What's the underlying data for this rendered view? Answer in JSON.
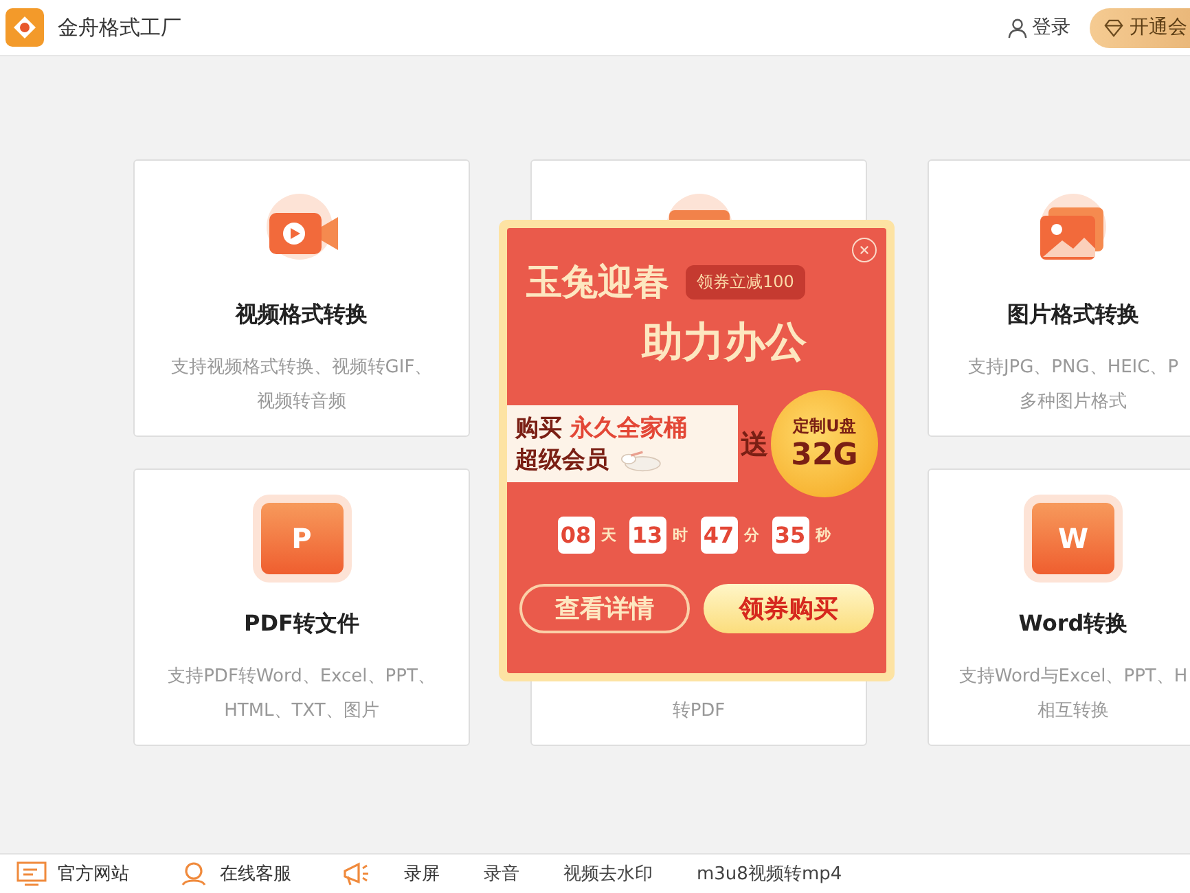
{
  "header": {
    "app_name": "金舟格式工厂",
    "login": "登录",
    "vip_button": "开通会"
  },
  "cards": [
    {
      "kind": "video",
      "title": "视频格式转换",
      "desc_lines": [
        "支持视频格式转换、视频转GIF、",
        "视频转音频"
      ]
    },
    {
      "kind": "covered"
    },
    {
      "kind": "image",
      "title": "图片格式转换",
      "desc_lines": [
        "支持JPG、PNG、HEIC、P",
        "多种图片格式"
      ]
    },
    {
      "kind": "pdf",
      "icon_letter": "P",
      "title": "PDF转文件",
      "desc_lines": [
        "支持PDF转Word、Excel、PPT、",
        "HTML、TXT、图片"
      ]
    },
    {
      "kind": "covered",
      "desc_lines": [
        "转PDF"
      ]
    },
    {
      "kind": "word",
      "icon_letter": "W",
      "title": "Word转换",
      "desc_lines": [
        "支持Word与Excel、PPT、H",
        "相互转换"
      ]
    }
  ],
  "popup": {
    "title_line1": "玉兔迎春",
    "title_line2": "助力办公",
    "coupon_tag": "领券立减100",
    "offer_prefix": "购买",
    "offer_highlight": "永久全家桶",
    "offer_line2": "超级会员",
    "gift_word": "送",
    "gift_line1": "定制U盘",
    "gift_line2": "32G",
    "countdown": [
      {
        "value": "08",
        "unit": "天"
      },
      {
        "value": "13",
        "unit": "时"
      },
      {
        "value": "47",
        "unit": "分"
      },
      {
        "value": "35",
        "unit": "秒"
      }
    ],
    "details_button": "查看详情",
    "buy_button": "领券购买"
  },
  "footer": [
    {
      "kind": "web",
      "label": "官方网站"
    },
    {
      "kind": "service",
      "label": "在线客服"
    },
    {
      "kind": "promo",
      "label": "录屏"
    },
    {
      "kind": "plain",
      "label": "录音"
    },
    {
      "kind": "plain",
      "label": "视频去水印"
    },
    {
      "kind": "plain",
      "label": "m3u8视频转mp4"
    }
  ]
}
